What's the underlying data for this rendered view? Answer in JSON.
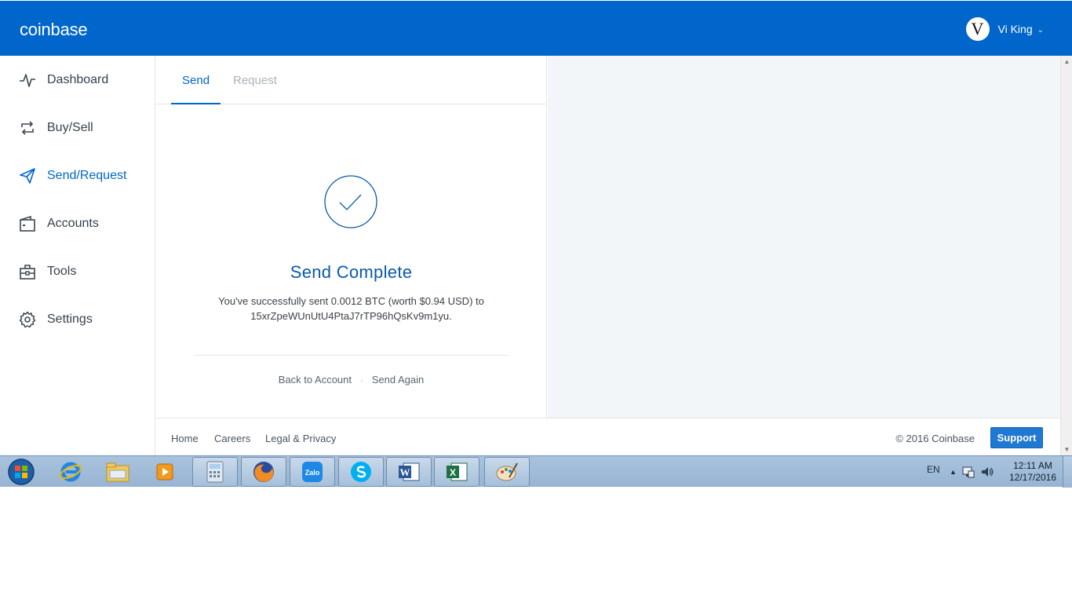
{
  "header": {
    "logo": "coinbase",
    "user_initial": "V",
    "user_name": "Vi King",
    "brand_color": "#0066cc"
  },
  "sidebar": {
    "items": [
      {
        "label": "Dashboard",
        "icon": "pulse-icon",
        "active": false
      },
      {
        "label": "Buy/Sell",
        "icon": "cycle-arrows-icon",
        "active": false
      },
      {
        "label": "Send/Request",
        "icon": "paper-plane-icon",
        "active": true
      },
      {
        "label": "Accounts",
        "icon": "wallet-icon",
        "active": false
      },
      {
        "label": "Tools",
        "icon": "toolbox-icon",
        "active": false
      },
      {
        "label": "Settings",
        "icon": "gear-icon",
        "active": false
      }
    ]
  },
  "tabs": {
    "send": "Send",
    "request": "Request",
    "active": "Send"
  },
  "result": {
    "title": "Send Complete",
    "line1": "You've successfully sent 0.0012 BTC (worth $0.94 USD) to",
    "line2": "15xrZpeWUnUtU4PtaJ7rTP96hQsKv9m1yu.",
    "back_label": "Back to Account",
    "separator": "·",
    "again_label": "Send Again"
  },
  "footer": {
    "links": [
      "Home",
      "Careers",
      "Legal & Privacy"
    ],
    "copyright": "© 2016 Coinbase",
    "support_label": "Support"
  },
  "taskbar": {
    "apps": [
      "start-orb",
      "internet-explorer",
      "file-explorer",
      "media-player",
      "calculator",
      "firefox",
      "zalo",
      "skype",
      "word",
      "excel",
      "paint"
    ],
    "zalo_label": "Zalo",
    "language": "EN",
    "time": "12:11 AM",
    "date": "12/17/2016"
  }
}
